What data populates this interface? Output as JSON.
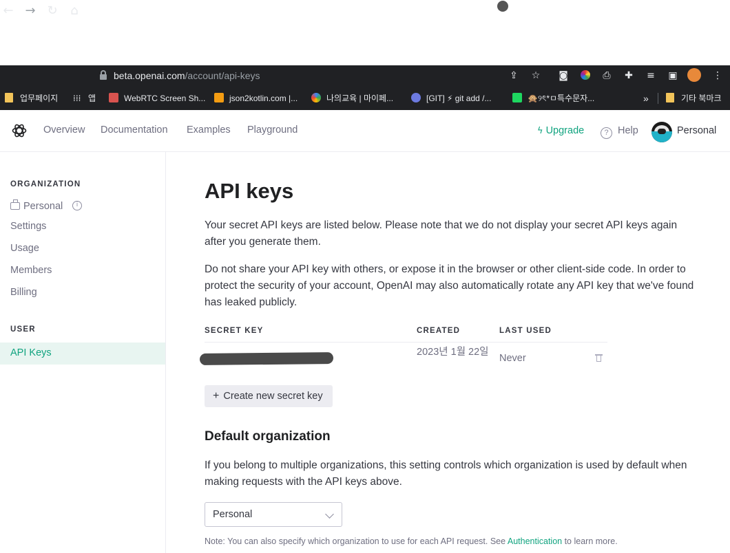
{
  "browser": {
    "url_host": "beta.openai.com",
    "url_path": "/account/api-keys",
    "bookmarks": [
      {
        "label": "업무페이지",
        "type": "folder"
      },
      {
        "label": "앱",
        "type": "apps"
      },
      {
        "label": "WebRTC Screen Sh...",
        "type": "site"
      },
      {
        "label": "json2kotlin.com |...",
        "type": "site"
      },
      {
        "label": "나의교육 | 마이페...",
        "type": "site"
      },
      {
        "label": "[GIT] ⚡ git add /...",
        "type": "site"
      },
      {
        "label": "🙊୨ৎ*ㅁ특수문자...",
        "type": "site"
      },
      {
        "label": "기타 북마크",
        "type": "folder"
      }
    ],
    "overflow_label": "»"
  },
  "header": {
    "nav": [
      "Overview",
      "Documentation",
      "Examples",
      "Playground"
    ],
    "upgrade_label": "Upgrade",
    "help_label": "Help",
    "account_label": "Personal"
  },
  "sidebar": {
    "org_heading": "ORGANIZATION",
    "org_name": "Personal",
    "org_items": [
      "Settings",
      "Usage",
      "Members",
      "Billing"
    ],
    "user_heading": "USER",
    "user_items": [
      "API Keys"
    ]
  },
  "main": {
    "title": "API keys",
    "intro_1": "Your secret API keys are listed below. Please note that we do not display your secret API keys again after you generate them.",
    "intro_2": "Do not share your API key with others, or expose it in the browser or other client-side code. In order to protect the security of your account, OpenAI may also automatically rotate any API key that we've found has leaked publicly.",
    "table": {
      "headers": [
        "SECRET KEY",
        "CREATED",
        "LAST USED"
      ],
      "rows": [
        {
          "created": "2023년 1월 22일",
          "last_used": "Never"
        }
      ]
    },
    "create_button_label": "Create new secret key",
    "default_org_heading": "Default organization",
    "default_org_text": "If you belong to multiple organizations, this setting controls which organization is used by default when making requests with the API keys above.",
    "default_org_selected": "Personal",
    "note_prefix": "Note: You can also specify which organization to use for each API request. See ",
    "note_link": "Authentication",
    "note_suffix": " to learn more."
  },
  "colors": {
    "accent": "#10a37f",
    "chrome_bg": "#202124"
  }
}
